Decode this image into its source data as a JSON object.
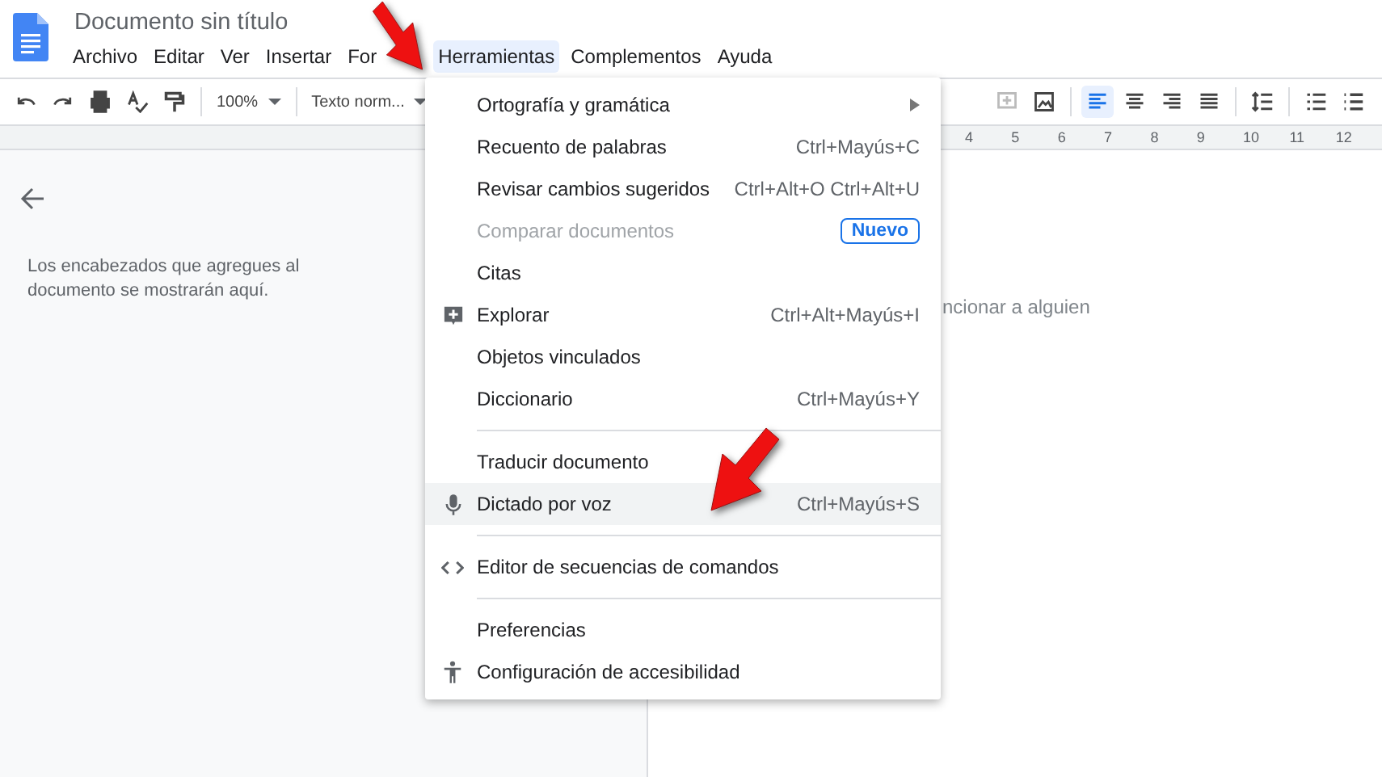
{
  "document": {
    "title": "Documento sin título"
  },
  "menubar": [
    {
      "label": "Archivo",
      "selected": false
    },
    {
      "label": "Editar",
      "selected": false
    },
    {
      "label": "Ver",
      "selected": false
    },
    {
      "label": "Insertar",
      "selected": false
    },
    {
      "label": "For",
      "selected": false
    },
    {
      "label": "Herramientas",
      "selected": true
    },
    {
      "label": "Complementos",
      "selected": false
    },
    {
      "label": "Ayuda",
      "selected": false
    }
  ],
  "toolbar_left": [
    {
      "kind": "undo"
    },
    {
      "kind": "redo"
    },
    {
      "kind": "print"
    },
    {
      "kind": "spellcheck"
    },
    {
      "kind": "paint"
    },
    {
      "kind": "sep"
    },
    {
      "kind": "dropdown",
      "label": "100%"
    },
    {
      "kind": "sep"
    },
    {
      "kind": "dropdown",
      "label": "Texto norm..."
    }
  ],
  "toolbar_right": [
    {
      "kind": "comment",
      "disabled": true
    },
    {
      "kind": "image"
    },
    {
      "kind": "sep"
    },
    {
      "kind": "align-left",
      "selected": true
    },
    {
      "kind": "align-center",
      "selected": false
    },
    {
      "kind": "align-right",
      "selected": false
    },
    {
      "kind": "justify",
      "selected": false
    },
    {
      "kind": "sep"
    },
    {
      "kind": "spacing"
    },
    {
      "kind": "sep"
    },
    {
      "kind": "numbered"
    },
    {
      "kind": "bulleted"
    }
  ],
  "ruler": {
    "labels": [
      "4",
      "5",
      "6",
      "7",
      "8",
      "9",
      "10",
      "11",
      "12"
    ]
  },
  "outline": {
    "message": "Los encabezados que agregues al documento se mostrarán aquí."
  },
  "page": {
    "text": "ncionar a alguien"
  },
  "tools_menu": [
    {
      "kind": "item",
      "label": "Ortografía y gramática",
      "submenu": true,
      "disabled": false,
      "highlighted": false
    },
    {
      "kind": "item",
      "label": "Recuento de palabras",
      "shortcut": "Ctrl+Mayús+C",
      "disabled": false,
      "highlighted": false
    },
    {
      "kind": "item",
      "label": "Revisar cambios sugeridos",
      "shortcut": "Ctrl+Alt+O Ctrl+Alt+U",
      "disabled": false,
      "highlighted": false
    },
    {
      "kind": "item",
      "label": "Comparar documentos",
      "badge": "Nuevo",
      "disabled": true,
      "highlighted": false
    },
    {
      "kind": "item",
      "label": "Citas",
      "disabled": false,
      "highlighted": false
    },
    {
      "kind": "explore",
      "label": "Explorar",
      "shortcut": "Ctrl+Alt+Mayús+I",
      "disabled": false,
      "highlighted": false
    },
    {
      "kind": "item",
      "label": "Objetos vinculados",
      "disabled": false,
      "highlighted": false
    },
    {
      "kind": "item",
      "label": "Diccionario",
      "shortcut": "Ctrl+Mayús+Y",
      "disabled": false,
      "highlighted": false
    },
    {
      "kind": "separator"
    },
    {
      "kind": "item",
      "label": "Traducir documento",
      "disabled": false,
      "highlighted": false
    },
    {
      "kind": "mic",
      "label": "Dictado por voz",
      "shortcut": "Ctrl+Mayús+S",
      "disabled": false,
      "highlighted": true
    },
    {
      "kind": "separator"
    },
    {
      "kind": "code",
      "label": "Editor de secuencias de comandos",
      "disabled": false,
      "highlighted": false
    },
    {
      "kind": "separator"
    },
    {
      "kind": "item",
      "label": "Preferencias",
      "disabled": false,
      "highlighted": false
    },
    {
      "kind": "accessibility",
      "label": "Configuración de accesibilidad",
      "disabled": false,
      "highlighted": false
    }
  ]
}
